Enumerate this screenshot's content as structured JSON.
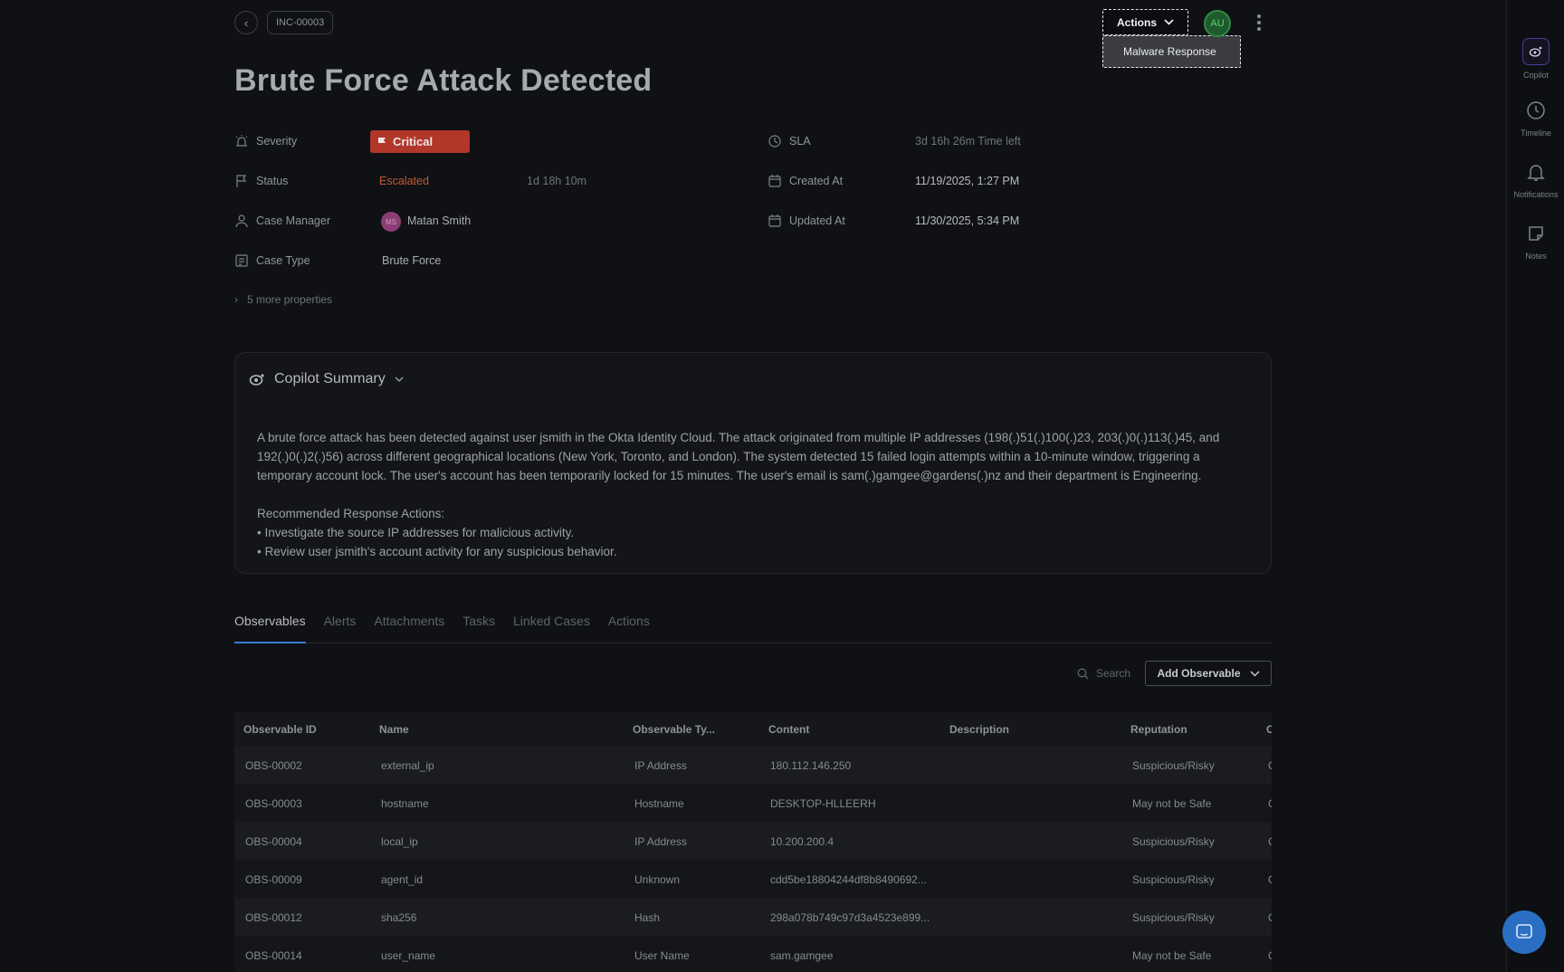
{
  "header": {
    "incident_id": "INC-00003",
    "actions_label": "Actions",
    "actions_menu_item": "Malware Response",
    "user_initials": "AU"
  },
  "title": "Brute Force Attack Detected",
  "properties": {
    "severity_label": "Severity",
    "severity_value": "Critical",
    "status_label": "Status",
    "status_value": "Escalated",
    "status_duration": "1d 18h 10m",
    "manager_label": "Case Manager",
    "manager_initials": "MS",
    "manager_name": "Matan Smith",
    "case_type_label": "Case Type",
    "case_type_value": "Brute Force",
    "sla_label": "SLA",
    "sla_value": "3d 16h 26m",
    "sla_suffix": "Time left",
    "created_label": "Created At",
    "created_value": "11/19/2025, 1:27 PM",
    "updated_label": "Updated At",
    "updated_value": "11/30/2025, 5:34 PM",
    "more_label": "5 more properties"
  },
  "summary": {
    "title": "Copilot Summary",
    "paragraph": "A brute force attack has been detected against user jsmith in the Okta Identity Cloud. The attack originated from multiple IP addresses (198(.)51(.)100(.)23, 203(.)0(.)113(.)45, and 192(.)0(.)2(.)56) across different geographical locations (New York, Toronto, and London). The system detected 15 failed login attempts within a 10-minute window, triggering a temporary account lock. The user's account has been temporarily locked for 15 minutes. The user's email is sam(.)gamgee@gardens(.)nz and their department is Engineering.",
    "actions_heading": "Recommended Response Actions:",
    "action_1": "• Investigate the source IP addresses for malicious activity.",
    "action_2": "• Review user jsmith's account activity for any suspicious behavior."
  },
  "tabs": [
    "Observables",
    "Alerts",
    "Attachments",
    "Tasks",
    "Linked Cases",
    "Actions"
  ],
  "toolbar": {
    "search_placeholder": "Search",
    "add_label": "Add Observable"
  },
  "table": {
    "headers": [
      "Observable ID",
      "Name",
      "Observable Ty...",
      "Content",
      "Description",
      "Reputation",
      "C"
    ],
    "rows": [
      [
        "OBS-00002",
        "external_ip",
        "IP Address",
        "180.112.146.250",
        "",
        "Suspicious/Risky",
        "C"
      ],
      [
        "OBS-00003",
        "hostname",
        "Hostname",
        "DESKTOP-HLLEERH",
        "",
        "May not be Safe",
        "C"
      ],
      [
        "OBS-00004",
        "local_ip",
        "IP Address",
        "10.200.200.4",
        "",
        "Suspicious/Risky",
        "C"
      ],
      [
        "OBS-00009",
        "agent_id",
        "Unknown",
        "cdd5be18804244df8b8490692...",
        "",
        "Suspicious/Risky",
        "C"
      ],
      [
        "OBS-00012",
        "sha256",
        "Hash",
        "298a078b749c97d3a4523e899...",
        "",
        "Suspicious/Risky",
        "C"
      ],
      [
        "OBS-00014",
        "user_name",
        "User Name",
        "sam.gamgee",
        "",
        "May not be Safe",
        "C"
      ]
    ]
  },
  "rail": {
    "copilot": "Copilot",
    "timeline": "Timeline",
    "notifications": "Notifications",
    "notes": "Notes"
  }
}
